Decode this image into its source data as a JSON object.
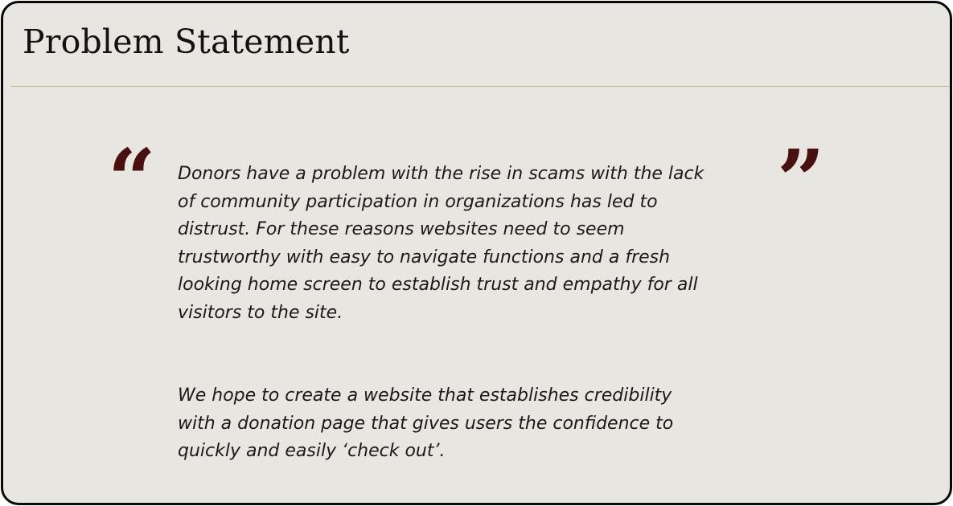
{
  "header": {
    "title": "Problem Statement"
  },
  "quote": {
    "open_mark": "“",
    "close_mark": "”",
    "paragraph_1": "Donors have a problem with the rise in scams with the lack\nof community participation in organizations has led to\ndistrust. For these reasons websites need to seem\ntrustworthy with easy to navigate functions and a fresh\nlooking home screen to establish trust and empathy for all\nvisitors to the site.",
    "paragraph_2": "We hope to create a website that establishes credibility\nwith a donation page that gives users the confidence to\nquickly and easily  ‘check out’."
  },
  "colors": {
    "card_background": "#e8e6e1",
    "card_border": "#0a0a0a",
    "divider": "#c8b682",
    "quote_mark": "#4a0f0f",
    "text": "#1a1a1a"
  }
}
